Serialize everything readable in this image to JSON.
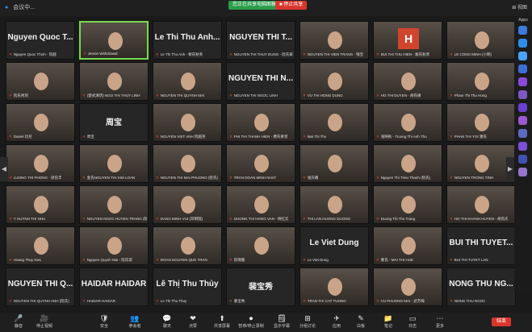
{
  "topbar": {
    "app_title": "会议中...",
    "share_label": "您正在共享电脑图稿",
    "stop_label": "■ 停止共享",
    "view_label": "⊞ 视图"
  },
  "sidebar": {
    "apps_label": "Apps"
  },
  "tiles": [
    {
      "big": "Nguyen Quoc T...",
      "cap": "Nguyen Quoc Thinh - 阮越",
      "type": "name"
    },
    {
      "big": "",
      "cap": "Jennie Withdrawal",
      "type": "photo",
      "active": true
    },
    {
      "big": "Le Thi Thu Anh...",
      "cap": "Le Thi Thu Anh - 黎氏秋英",
      "type": "name"
    },
    {
      "big": "NGUYEN THI T...",
      "cap": "NGUYEN THI THUY DUNG - 阮氏翠",
      "type": "name"
    },
    {
      "big": "",
      "cap": "NGUYEN THI VIEN TRANG - 钱宝",
      "type": "photo"
    },
    {
      "big": "",
      "cap": "BUI THI THU HIEN - 裴氏秋贤",
      "type": "avatarH"
    },
    {
      "big": "",
      "cap": "LE CONG MINH (小明)",
      "type": "photo"
    },
    {
      "big": "",
      "cap": "阮氏青玥",
      "type": "photo"
    },
    {
      "big": "",
      "cap": "(楚式清玥) NGO THI THUY LINH",
      "type": "photo"
    },
    {
      "big": "",
      "cap": "NGUYEN THI QUYNH MAI",
      "type": "photo"
    },
    {
      "big": "NGUYEN THI N...",
      "cap": "NGUYEN THI NGOC LINH",
      "type": "name"
    },
    {
      "big": "",
      "cap": "VU THI HONG DUNG",
      "type": "photo"
    },
    {
      "big": "",
      "cap": "HO THI DUYEN - 胡氏缘",
      "type": "photo"
    },
    {
      "big": "",
      "cap": "Pham Thi Thu Hong",
      "type": "photo"
    },
    {
      "big": "",
      "cap": "Daniel 达尼",
      "type": "photo"
    },
    {
      "big": "周宝",
      "cap": "周宝",
      "type": "name"
    },
    {
      "big": "",
      "cap": "NGUYEN VIET ANH 阮越英",
      "type": "photo"
    },
    {
      "big": "",
      "cap": "PHI THI THANH HIEN - 费氏青贤",
      "type": "photo"
    },
    {
      "big": "",
      "cap": "Mai Thi Thu",
      "type": "photo"
    },
    {
      "big": "",
      "cap": "张映秋 - Truong Thi Anh Thu",
      "type": "photo"
    },
    {
      "big": "",
      "cap": "PHAN THI YOI 潘氏",
      "type": "photo"
    },
    {
      "big": "",
      "cap": "LUONG THI PHONG - 梁氏丰",
      "type": "photo"
    },
    {
      "big": "",
      "cap": "金氏NGUYEN THI KIM LOAN",
      "type": "photo"
    },
    {
      "big": "",
      "cap": "NGUYEN THI MAI PHUONG (阮氏)",
      "type": "photo"
    },
    {
      "big": "",
      "cap": "TRAN DOAN MINH NHAT",
      "type": "photo"
    },
    {
      "big": "",
      "cap": "张庆娥",
      "type": "photo"
    },
    {
      "big": "",
      "cap": "Nguyen Thi Trieu Thanh (阮氏)",
      "type": "photo"
    },
    {
      "big": "",
      "cap": "NGUYEN TRONG TINH",
      "type": "photo"
    },
    {
      "big": "",
      "cap": "Y HUYNH THI NHU",
      "type": "photo"
    },
    {
      "big": "",
      "cap": "NGUYEN NGOC HUYEN TRANG (阮)",
      "type": "photo"
    },
    {
      "big": "",
      "cap": "DANG MINH VUI (邓明瑞)",
      "type": "photo"
    },
    {
      "big": "",
      "cap": "DUONG THI HONG VAN - 杨红云",
      "type": "photo"
    },
    {
      "big": "",
      "cap": "THI LAN HUONG DUONG",
      "type": "photo"
    },
    {
      "big": "",
      "cap": "Duong Thi Thu Trang",
      "type": "photo"
    },
    {
      "big": "",
      "cap": "HO THI KHANH HUYEN - 胡氏庆",
      "type": "photo"
    },
    {
      "big": "",
      "cap": "Hoang Thuy Kieu",
      "type": "photo"
    },
    {
      "big": "",
      "cap": "Nguyen Quynh Mai - 阮氏琼",
      "type": "photo"
    },
    {
      "big": "",
      "cap": "DOAN NGUYEN QUE TRAN",
      "type": "photo"
    },
    {
      "big": "",
      "cap": "阮瑀雁",
      "type": "photo"
    },
    {
      "big": "Le Viet Dung",
      "cap": "Le Viet Dung",
      "type": "name"
    },
    {
      "big": "",
      "cap": "黎氏 - MAI THI HUE",
      "type": "photo"
    },
    {
      "big": "BUI THI TUYET...",
      "cap": "BUI THI TUYET LAN",
      "type": "name"
    },
    {
      "big": "NGUYEN THI Q...",
      "cap": "NGUYEN THI QUYNH ANH (阮氏)",
      "type": "name"
    },
    {
      "big": "HAIDAR HAIDAR",
      "cap": "HAIDAR HAIDAR",
      "type": "name"
    },
    {
      "big": "Lê Thị Thu Thủy",
      "cap": "Le Thi Thu Thuy",
      "type": "name"
    },
    {
      "big": "裴宝秀",
      "cap": "裴宝秀",
      "type": "name"
    },
    {
      "big": "",
      "cap": "TRAN THI CAT TUONG",
      "type": "photo"
    },
    {
      "big": "",
      "cap": "VU PHUONG MAI - 武芳梅",
      "type": "photo"
    },
    {
      "big": "NONG THU NG...",
      "cap": "NONG THU NGOC",
      "type": "name"
    }
  ],
  "footer": {
    "buttons": [
      {
        "icon": "🎤",
        "label": "静音"
      },
      {
        "icon": "🎥",
        "label": "停止视频"
      },
      {
        "icon": "🛡",
        "label": "安全"
      },
      {
        "icon": "👥",
        "label": "参会者"
      },
      {
        "icon": "💬",
        "label": "聊天"
      },
      {
        "icon": "❤",
        "label": "点赞"
      },
      {
        "icon": "⬆",
        "label": "共享屏幕"
      },
      {
        "icon": "⏺",
        "label": "暂停/停止录制"
      },
      {
        "icon": "🗒",
        "label": "显示字幕"
      },
      {
        "icon": "⊞",
        "label": "分组讨论"
      },
      {
        "icon": "✈",
        "label": "应用"
      },
      {
        "icon": "✎",
        "label": "白板"
      },
      {
        "icon": "📁",
        "label": "笔记"
      },
      {
        "icon": "▭",
        "label": "日志"
      },
      {
        "icon": "⋯",
        "label": "更多"
      }
    ],
    "end_label": "结束",
    "participants_count": "65"
  },
  "page_indicator": {
    "left": "1/2",
    "right": "1/2"
  }
}
